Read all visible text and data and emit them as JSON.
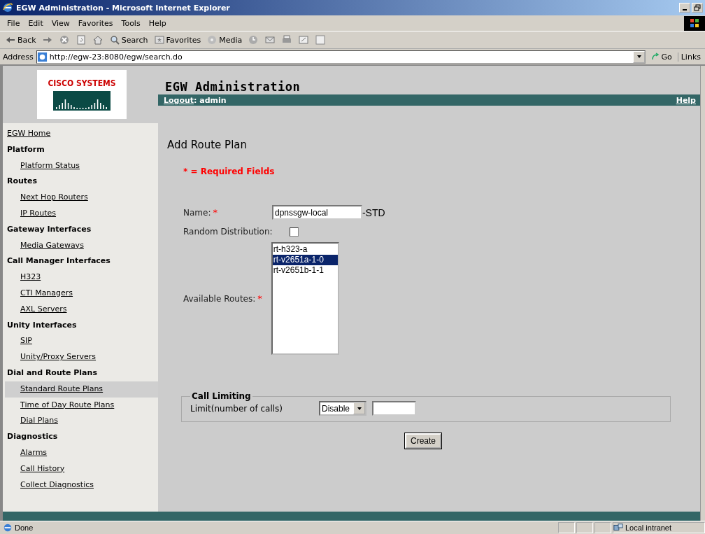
{
  "window": {
    "title": "EGW Administration - Microsoft Internet Explorer"
  },
  "menu_bar": [
    "File",
    "Edit",
    "View",
    "Favorites",
    "Tools",
    "Help"
  ],
  "toolbar": [
    {
      "kind": "back",
      "label": "Back"
    },
    {
      "kind": "forward"
    },
    {
      "kind": "stop"
    },
    {
      "kind": "refresh"
    },
    {
      "kind": "home"
    },
    {
      "kind": "search",
      "label": "Search"
    },
    {
      "kind": "favorites",
      "label": "Favorites"
    },
    {
      "kind": "media",
      "label": "Media"
    },
    {
      "kind": "history"
    },
    {
      "kind": "mail"
    },
    {
      "kind": "print"
    },
    {
      "kind": "edit"
    },
    {
      "kind": "discuss"
    }
  ],
  "address_bar": {
    "label": "Address",
    "url": "http://egw-23:8080/egw/search.do",
    "go": "Go",
    "links": "Links"
  },
  "logo": {
    "text": "CISCO SYSTEMS"
  },
  "header": {
    "title": "EGW Administration",
    "logout": "Logout",
    "user": ": admin",
    "help": "Help"
  },
  "sidebar": {
    "items": [
      {
        "kind": "link",
        "label": "EGW Home",
        "selected": false
      },
      {
        "kind": "heading",
        "label": "Platform",
        "children": [
          {
            "label": "Platform Status",
            "selected": false
          }
        ]
      },
      {
        "kind": "heading",
        "label": "Routes",
        "children": [
          {
            "label": "Next Hop Routers",
            "selected": false
          },
          {
            "label": "IP Routes",
            "selected": false
          }
        ]
      },
      {
        "kind": "heading",
        "label": "Gateway Interfaces",
        "children": [
          {
            "label": "Media Gateways",
            "selected": false
          }
        ]
      },
      {
        "kind": "heading",
        "label": "Call Manager Interfaces",
        "children": [
          {
            "label": "H323",
            "selected": false
          },
          {
            "label": "CTI Managers",
            "selected": false
          },
          {
            "label": "AXL Servers",
            "selected": false
          }
        ]
      },
      {
        "kind": "heading",
        "label": "Unity Interfaces",
        "children": [
          {
            "label": "SIP",
            "selected": false
          },
          {
            "label": "Unity/Proxy Servers",
            "selected": false
          }
        ]
      },
      {
        "kind": "heading",
        "label": "Dial and Route Plans",
        "children": [
          {
            "label": "Standard Route Plans",
            "selected": true
          },
          {
            "label": "Time of Day Route Plans",
            "selected": false
          },
          {
            "label": "Dial Plans",
            "selected": false
          }
        ]
      },
      {
        "kind": "heading",
        "label": "Diagnostics",
        "children": [
          {
            "label": "Alarms",
            "selected": false
          },
          {
            "label": "Call History",
            "selected": false
          },
          {
            "label": "Collect Diagnostics",
            "selected": false
          }
        ]
      }
    ]
  },
  "form": {
    "title": "Add Route Plan",
    "required_note": "* = Required Fields",
    "name": {
      "label": "Name:",
      "required_mark": "*",
      "value": "dpnssgw-local",
      "suffix": "-STD"
    },
    "random_distribution": {
      "label": "Random Distribution:",
      "checked": false
    },
    "available_routes": {
      "label": "Available Routes:",
      "required_mark": "*",
      "options": [
        {
          "label": "rt-h323-a",
          "selected": false
        },
        {
          "label": "rt-v2651a-1-0",
          "selected": true
        },
        {
          "label": "rt-v2651b-1-1",
          "selected": false
        }
      ]
    },
    "call_limiting": {
      "legend": "Call Limiting",
      "label": "Limit(number of calls)",
      "mode": "Disable"
    },
    "create_button": "Create"
  },
  "status_bar": {
    "text": "Done",
    "zone": "Local intranet"
  }
}
